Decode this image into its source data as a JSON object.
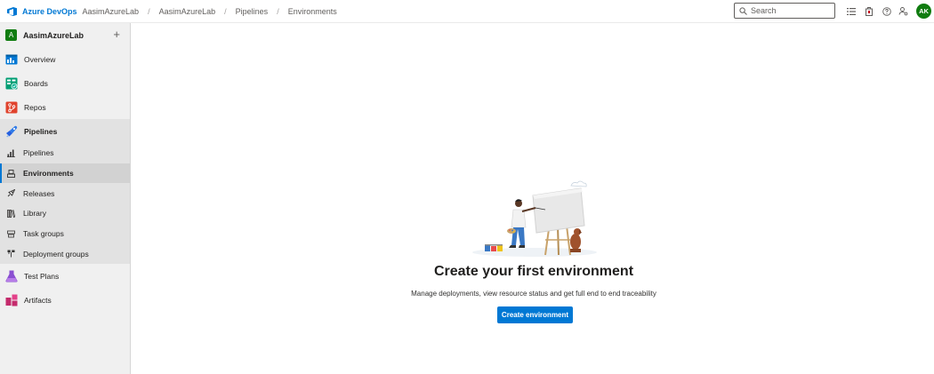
{
  "header": {
    "brand": "Azure DevOps",
    "breadcrumbs": [
      "AasimAzureLab",
      "AasimAzureLab",
      "Pipelines",
      "Environments"
    ],
    "search_placeholder": "Search",
    "icons": [
      "list-icon",
      "shopping-bag-icon",
      "help-icon",
      "user-settings-icon"
    ],
    "avatar_initials": "AK"
  },
  "sidebar": {
    "project_initial": "A",
    "project_name": "AasimAzureLab",
    "add_label": "+",
    "items": [
      {
        "label": "Overview",
        "icon": "overview-icon"
      },
      {
        "label": "Boards",
        "icon": "boards-icon"
      },
      {
        "label": "Repos",
        "icon": "repos-icon"
      },
      {
        "label": "Pipelines",
        "icon": "pipelines-icon"
      }
    ],
    "pipelines_sub": [
      {
        "label": "Pipelines",
        "icon": "pipelines-sub-icon"
      },
      {
        "label": "Environments",
        "icon": "environments-icon",
        "selected": true
      },
      {
        "label": "Releases",
        "icon": "releases-icon"
      },
      {
        "label": "Library",
        "icon": "library-icon"
      },
      {
        "label": "Task groups",
        "icon": "task-groups-icon"
      },
      {
        "label": "Deployment groups",
        "icon": "deployment-groups-icon"
      }
    ],
    "bottom_items": [
      {
        "label": "Test Plans",
        "icon": "test-plans-icon"
      },
      {
        "label": "Artifacts",
        "icon": "artifacts-icon"
      }
    ]
  },
  "main": {
    "title": "Create your first environment",
    "description": "Manage deployments, view resource status and get full end to end traceability",
    "button_label": "Create environment"
  },
  "colors": {
    "accent": "#0078d4",
    "avatar": "#107c10",
    "sidebar_bg": "#f0f0f0",
    "sub_group_bg": "#e2e2e2",
    "selected_bg": "#d2d2d2"
  }
}
